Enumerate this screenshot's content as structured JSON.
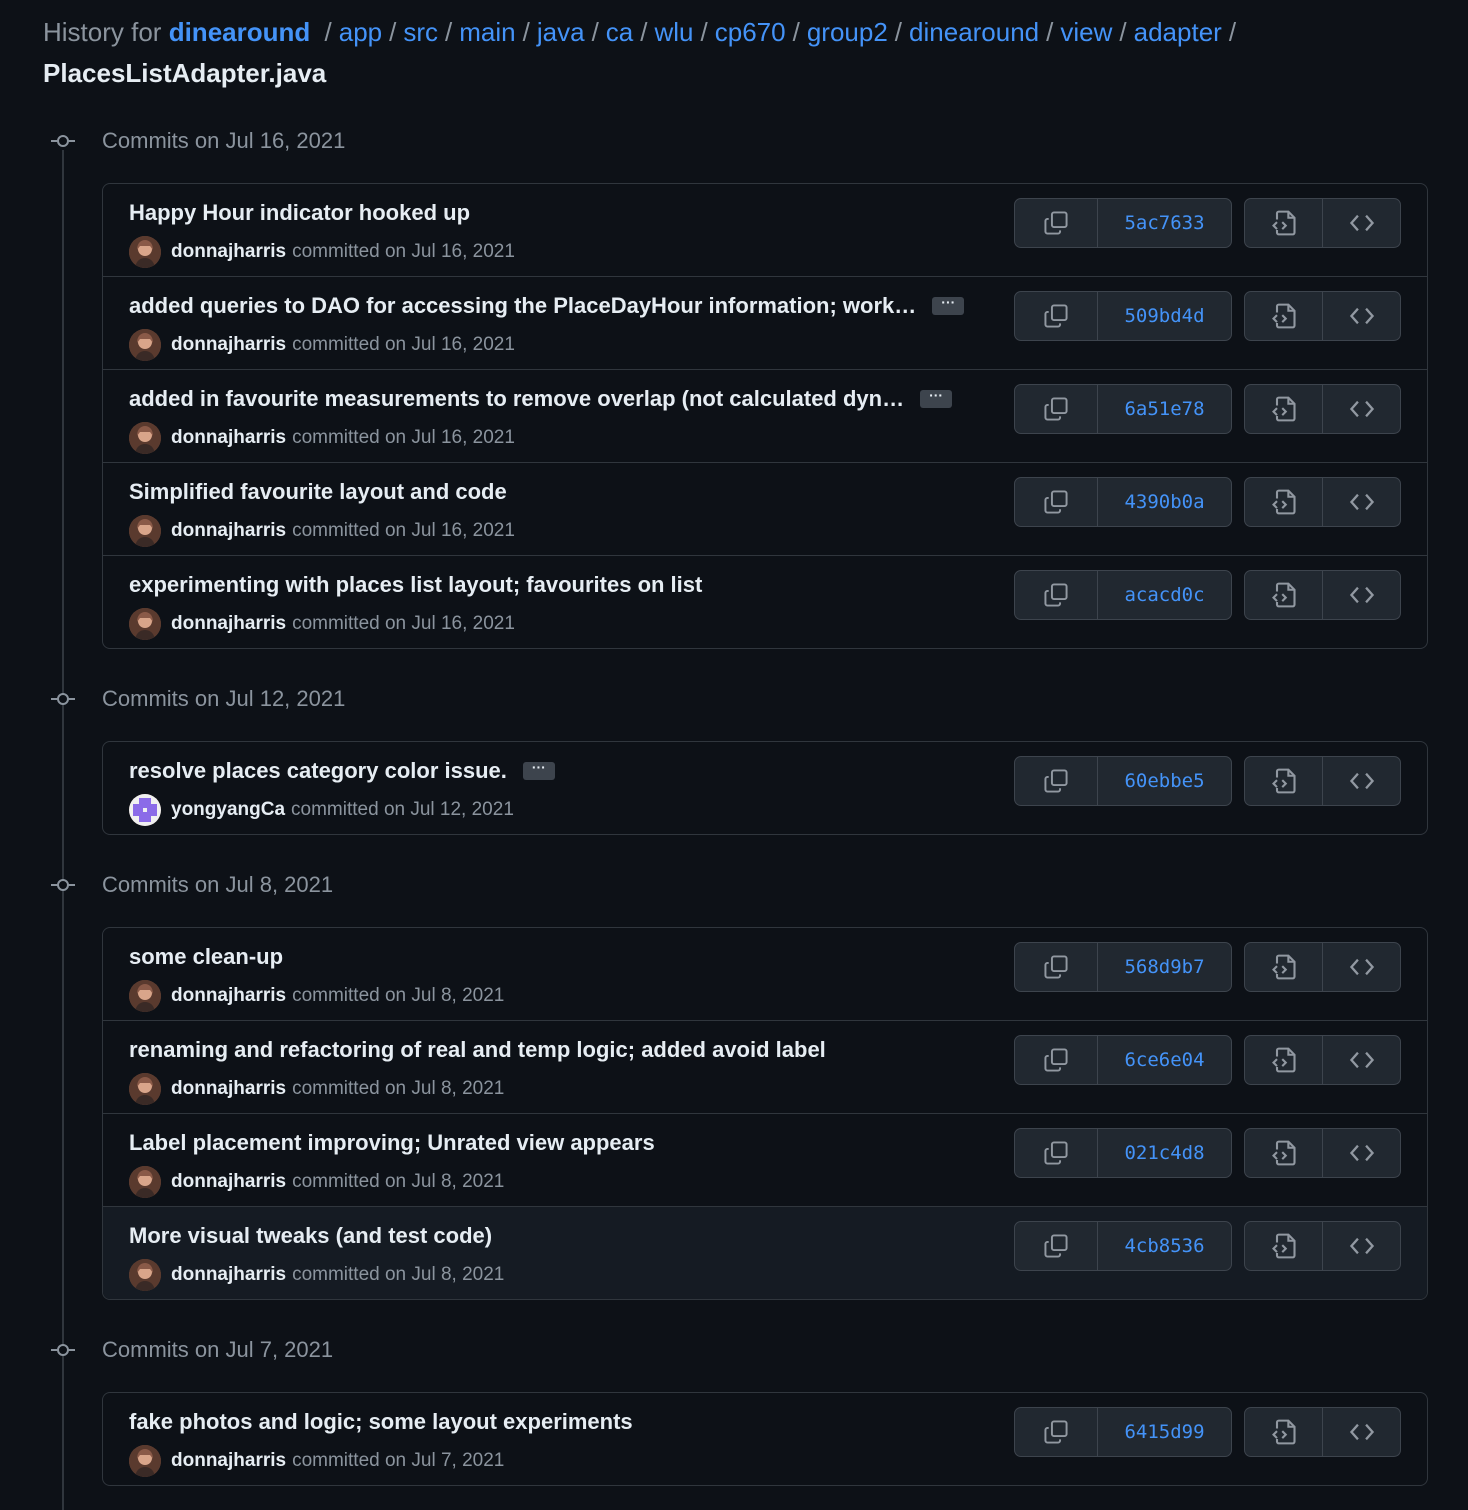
{
  "header": {
    "prefix": "History for",
    "repo": "dinearound",
    "path": [
      "app",
      "src",
      "main",
      "java",
      "ca",
      "wlu",
      "cp670",
      "group2",
      "dinearound",
      "view",
      "adapter"
    ],
    "file": "PlacesListAdapter.java"
  },
  "groups": [
    {
      "title": "Commits on Jul 16, 2021",
      "commits": [
        {
          "message": "Happy Hour indicator hooked up",
          "has_more": false,
          "author": "donnajharris",
          "when": "committed on Jul 16, 2021",
          "sha": "5ac7633"
        },
        {
          "message": "added queries to DAO for accessing the PlaceDayHour information; work…",
          "has_more": true,
          "author": "donnajharris",
          "when": "committed on Jul 16, 2021",
          "sha": "509bd4d"
        },
        {
          "message": "added in favourite measurements to remove overlap (not calculated dyn…",
          "has_more": true,
          "author": "donnajharris",
          "when": "committed on Jul 16, 2021",
          "sha": "6a51e78"
        },
        {
          "message": "Simplified favourite layout and code",
          "has_more": false,
          "author": "donnajharris",
          "when": "committed on Jul 16, 2021",
          "sha": "4390b0a"
        },
        {
          "message": "experimenting with places list layout; favourites on list",
          "has_more": false,
          "author": "donnajharris",
          "when": "committed on Jul 16, 2021",
          "sha": "acacd0c"
        }
      ]
    },
    {
      "title": "Commits on Jul 12, 2021",
      "commits": [
        {
          "message": "resolve places category color issue.",
          "has_more": true,
          "author": "yongyangCa",
          "when": "committed on Jul 12, 2021",
          "sha": "60ebbe5"
        }
      ]
    },
    {
      "title": "Commits on Jul 8, 2021",
      "commits": [
        {
          "message": "some clean-up",
          "has_more": false,
          "author": "donnajharris",
          "when": "committed on Jul 8, 2021",
          "sha": "568d9b7"
        },
        {
          "message": "renaming and refactoring of real and temp logic; added avoid label",
          "has_more": false,
          "author": "donnajharris",
          "when": "committed on Jul 8, 2021",
          "sha": "6ce6e04"
        },
        {
          "message": "Label placement improving; Unrated view appears",
          "has_more": false,
          "author": "donnajharris",
          "when": "committed on Jul 8, 2021",
          "sha": "021c4d8"
        },
        {
          "message": "More visual tweaks (and test code)",
          "has_more": false,
          "author": "donnajharris",
          "when": "committed on Jul 8, 2021",
          "sha": "4cb8536"
        }
      ]
    },
    {
      "title": "Commits on Jul 7, 2021",
      "commits": [
        {
          "message": "fake photos and logic; some layout experiments",
          "has_more": false,
          "author": "donnajharris",
          "when": "committed on Jul 7, 2021",
          "sha": "6415d99"
        }
      ]
    }
  ],
  "icons": {
    "copy": "copy-icon",
    "browse_files": "file-code-icon",
    "browse_repo": "code-icon",
    "more": "ellipsis-icon",
    "timeline": "git-commit-icon"
  },
  "colors": {
    "background": "#0d1117",
    "link": "#4493f8",
    "muted": "#8b949e",
    "border": "#30363d"
  }
}
